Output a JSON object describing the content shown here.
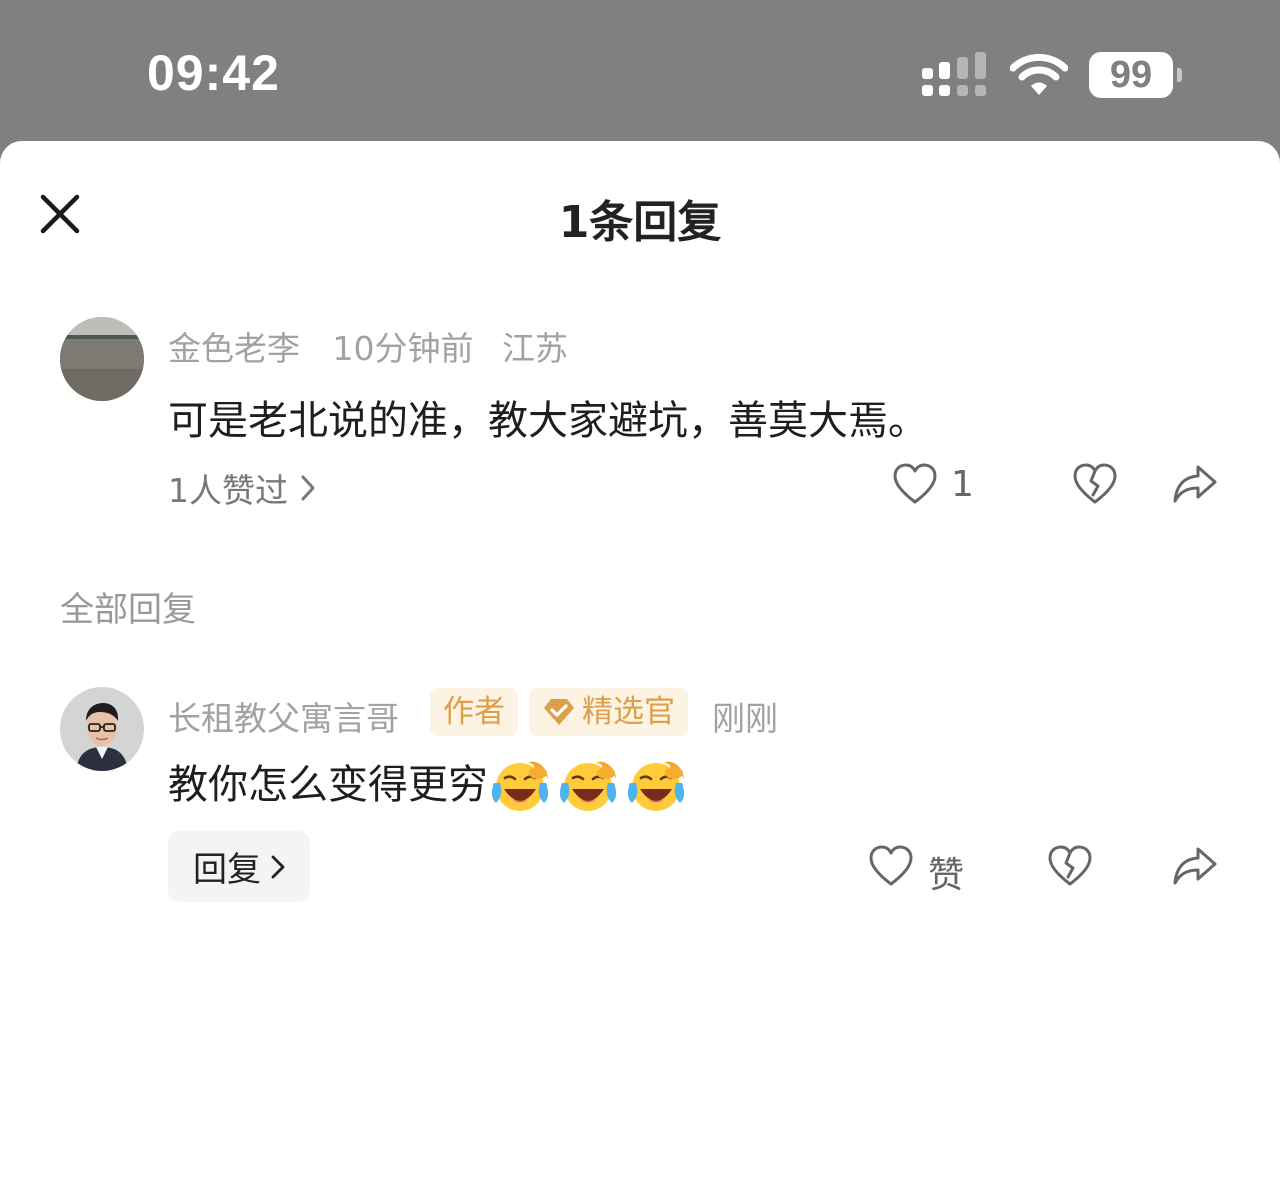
{
  "status_bar": {
    "time": "09:42",
    "battery": "99"
  },
  "sheet": {
    "title": "1条回复"
  },
  "comment": {
    "username": "金色老李",
    "time": "10分钟前",
    "location": "江苏",
    "text": "可是老北说的准，教大家避坑，善莫大焉。",
    "likers": "1人赞过",
    "like_count": "1"
  },
  "section": {
    "label": "全部回复"
  },
  "reply": {
    "username": "长租教父寓言哥",
    "author_badge": "作者",
    "curator_badge": "精选官",
    "time": "刚刚",
    "text": "教你怎么变得更穷",
    "emoji": "laughing-crying-face",
    "like_label": "赞",
    "reply_button": "回复"
  },
  "colors": {
    "status_bg": "#808080",
    "badge_bg": "#fdf3e2",
    "badge_text": "#dca04d"
  }
}
